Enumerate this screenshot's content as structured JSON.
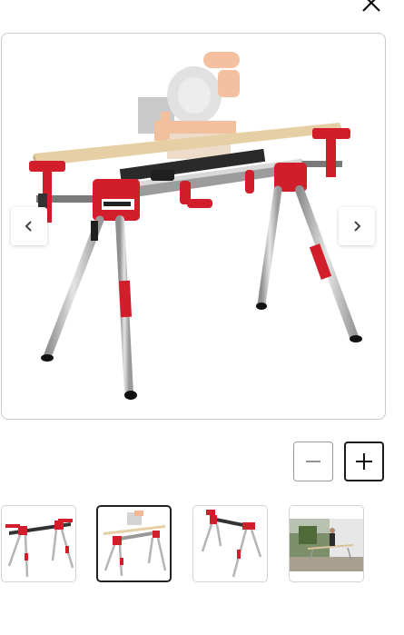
{
  "viewer": {
    "close_icon": "close-icon",
    "prev_icon": "chevron-left-icon",
    "next_icon": "chevron-right-icon"
  },
  "zoom": {
    "out_icon": "minus-icon",
    "in_icon": "plus-icon"
  },
  "thumbnails": {
    "count": 4,
    "selected_index": 1
  },
  "colors": {
    "accent_red": "#d21e2b",
    "leg_silver": "#b4b4b4",
    "border": "#c9c9c9"
  }
}
